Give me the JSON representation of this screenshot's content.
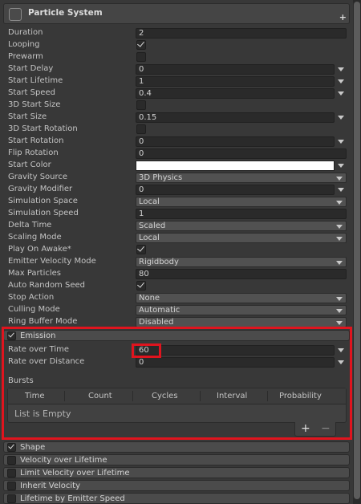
{
  "header": {
    "title": "Particle System"
  },
  "rows": [
    {
      "label": "Duration",
      "kind": "field",
      "value": "2"
    },
    {
      "label": "Looping",
      "kind": "checkbox",
      "checked": true
    },
    {
      "label": "Prewarm",
      "kind": "checkbox",
      "checked": false
    },
    {
      "label": "Start Delay",
      "kind": "field-arrow",
      "value": "0"
    },
    {
      "label": "Start Lifetime",
      "kind": "field-arrow",
      "value": "1"
    },
    {
      "label": "Start Speed",
      "kind": "field-arrow",
      "value": "0.4"
    },
    {
      "label": "3D Start Size",
      "kind": "checkbox",
      "checked": false
    },
    {
      "label": "Start Size",
      "kind": "field-arrow",
      "value": "0.15"
    },
    {
      "label": "3D Start Rotation",
      "kind": "checkbox",
      "checked": false
    },
    {
      "label": "Start Rotation",
      "kind": "field-arrow",
      "value": "0"
    },
    {
      "label": "Flip Rotation",
      "kind": "field",
      "value": "0"
    },
    {
      "label": "Start Color",
      "kind": "color",
      "value": "#ffffff"
    },
    {
      "label": "Gravity Source",
      "kind": "dropdown",
      "value": "3D Physics"
    },
    {
      "label": "Gravity Modifier",
      "kind": "field-arrow",
      "value": "0"
    },
    {
      "label": "Simulation Space",
      "kind": "dropdown",
      "value": "Local"
    },
    {
      "label": "Simulation Speed",
      "kind": "field",
      "value": "1"
    },
    {
      "label": "Delta Time",
      "kind": "dropdown",
      "value": "Scaled"
    },
    {
      "label": "Scaling Mode",
      "kind": "dropdown",
      "value": "Local"
    },
    {
      "label": "Play On Awake*",
      "kind": "checkbox",
      "checked": true
    },
    {
      "label": "Emitter Velocity Mode",
      "kind": "dropdown",
      "value": "Rigidbody"
    },
    {
      "label": "Max Particles",
      "kind": "field",
      "value": "80"
    },
    {
      "label": "Auto Random Seed",
      "kind": "checkbox",
      "checked": true
    },
    {
      "label": "Stop Action",
      "kind": "dropdown",
      "value": "None"
    },
    {
      "label": "Culling Mode",
      "kind": "dropdown",
      "value": "Automatic"
    },
    {
      "label": "Ring Buffer Mode",
      "kind": "dropdown",
      "value": "Disabled"
    }
  ],
  "emission": {
    "label": "Emission",
    "enabled": true,
    "rows": [
      {
        "label": "Rate over Time",
        "kind": "field-arrow",
        "value": "60"
      },
      {
        "label": "Rate over Distance",
        "kind": "field-arrow",
        "value": "0"
      }
    ],
    "bursts": {
      "label": "Bursts",
      "columns": [
        "Time",
        "Count",
        "Cycles",
        "Interval",
        "Probability"
      ],
      "empty_text": "List is Empty",
      "add_label": "+",
      "remove_label": "−"
    }
  },
  "modules": [
    {
      "label": "Shape",
      "enabled": true
    },
    {
      "label": "Velocity over Lifetime",
      "enabled": false
    },
    {
      "label": "Limit Velocity over Lifetime",
      "enabled": false
    },
    {
      "label": "Inherit Velocity",
      "enabled": false
    },
    {
      "label": "Lifetime by Emitter Speed",
      "enabled": false
    }
  ],
  "icons": {
    "component": "particle-system-icon",
    "add_component": "plus-icon",
    "highlight_color": "#e0141e"
  }
}
